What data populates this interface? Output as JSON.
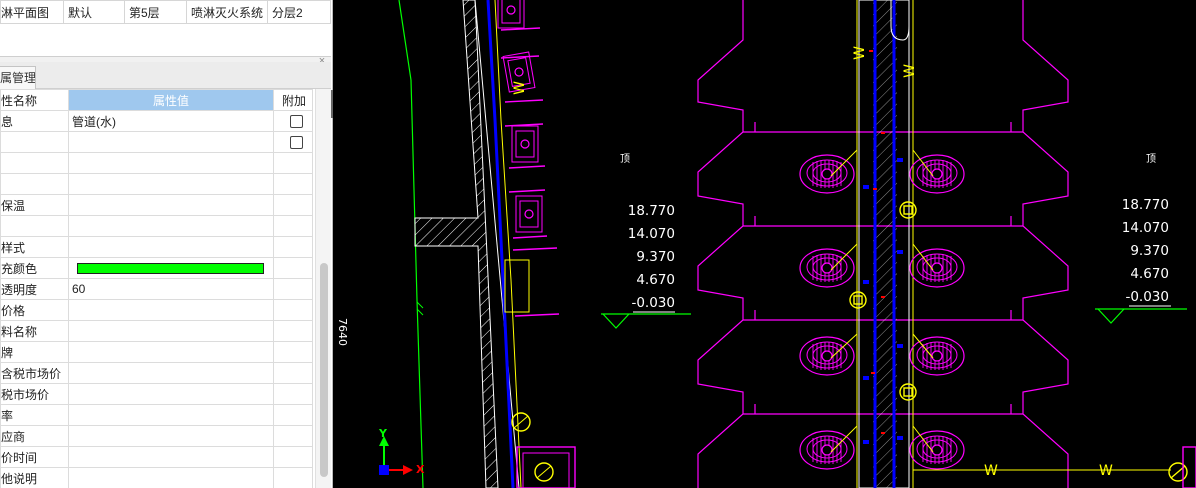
{
  "floor_row": {
    "drawing": "淋平面图",
    "mode": "默认",
    "floor": "第5层",
    "system": "喷淋灭火系统",
    "layer": "分层2"
  },
  "properties_tab": "属管理",
  "prop_headers": {
    "name": "性名称",
    "value": "属性值",
    "extra": "附加"
  },
  "properties": [
    {
      "name": "息",
      "value": "管道(水)",
      "checkbox": true
    },
    {
      "name": "",
      "value": "",
      "checkbox": true
    },
    {
      "name": "",
      "value": "",
      "checkbox": false
    },
    {
      "name": "",
      "value": "",
      "checkbox": false
    },
    {
      "name": "保温",
      "value": "",
      "checkbox": false
    },
    {
      "name": "",
      "value": "",
      "checkbox": false
    },
    {
      "name": "样式",
      "value": "",
      "checkbox": false
    },
    {
      "name": "充颜色",
      "value": "",
      "swatch": "#00ff00",
      "checkbox": false
    },
    {
      "name": "透明度",
      "value": "60",
      "checkbox": false
    },
    {
      "name": "价格",
      "value": "",
      "checkbox": false
    },
    {
      "name": "料名称",
      "value": "",
      "checkbox": false
    },
    {
      "name": "牌",
      "value": "",
      "checkbox": false
    },
    {
      "name": "含税市场价",
      "value": "",
      "checkbox": false
    },
    {
      "name": "税市场价",
      "value": "",
      "checkbox": false
    },
    {
      "name": "率",
      "value": "",
      "checkbox": false
    },
    {
      "name": "应商",
      "value": "",
      "checkbox": false
    },
    {
      "name": "价时间",
      "value": "",
      "checkbox": false
    },
    {
      "name": "他说明",
      "value": "",
      "checkbox": false
    }
  ],
  "cad": {
    "elevations_left": [
      "18.770",
      "14.070",
      "9.370",
      "4.670",
      "-0.030"
    ],
    "elevations_right": [
      "18.770",
      "14.070",
      "9.370",
      "4.670",
      "-0.030"
    ],
    "floor_label_left": "顶",
    "floor_label_right": "顶",
    "dimension": "7640",
    "pipe_label": "W",
    "axis_y": "Y",
    "axis_x": "X",
    "colors": {
      "pipe": "#0000ff",
      "water_line": "#ffff00",
      "fixtures": "#ff00ff",
      "wall": "#ffffff",
      "grid": "#00ff00"
    }
  }
}
